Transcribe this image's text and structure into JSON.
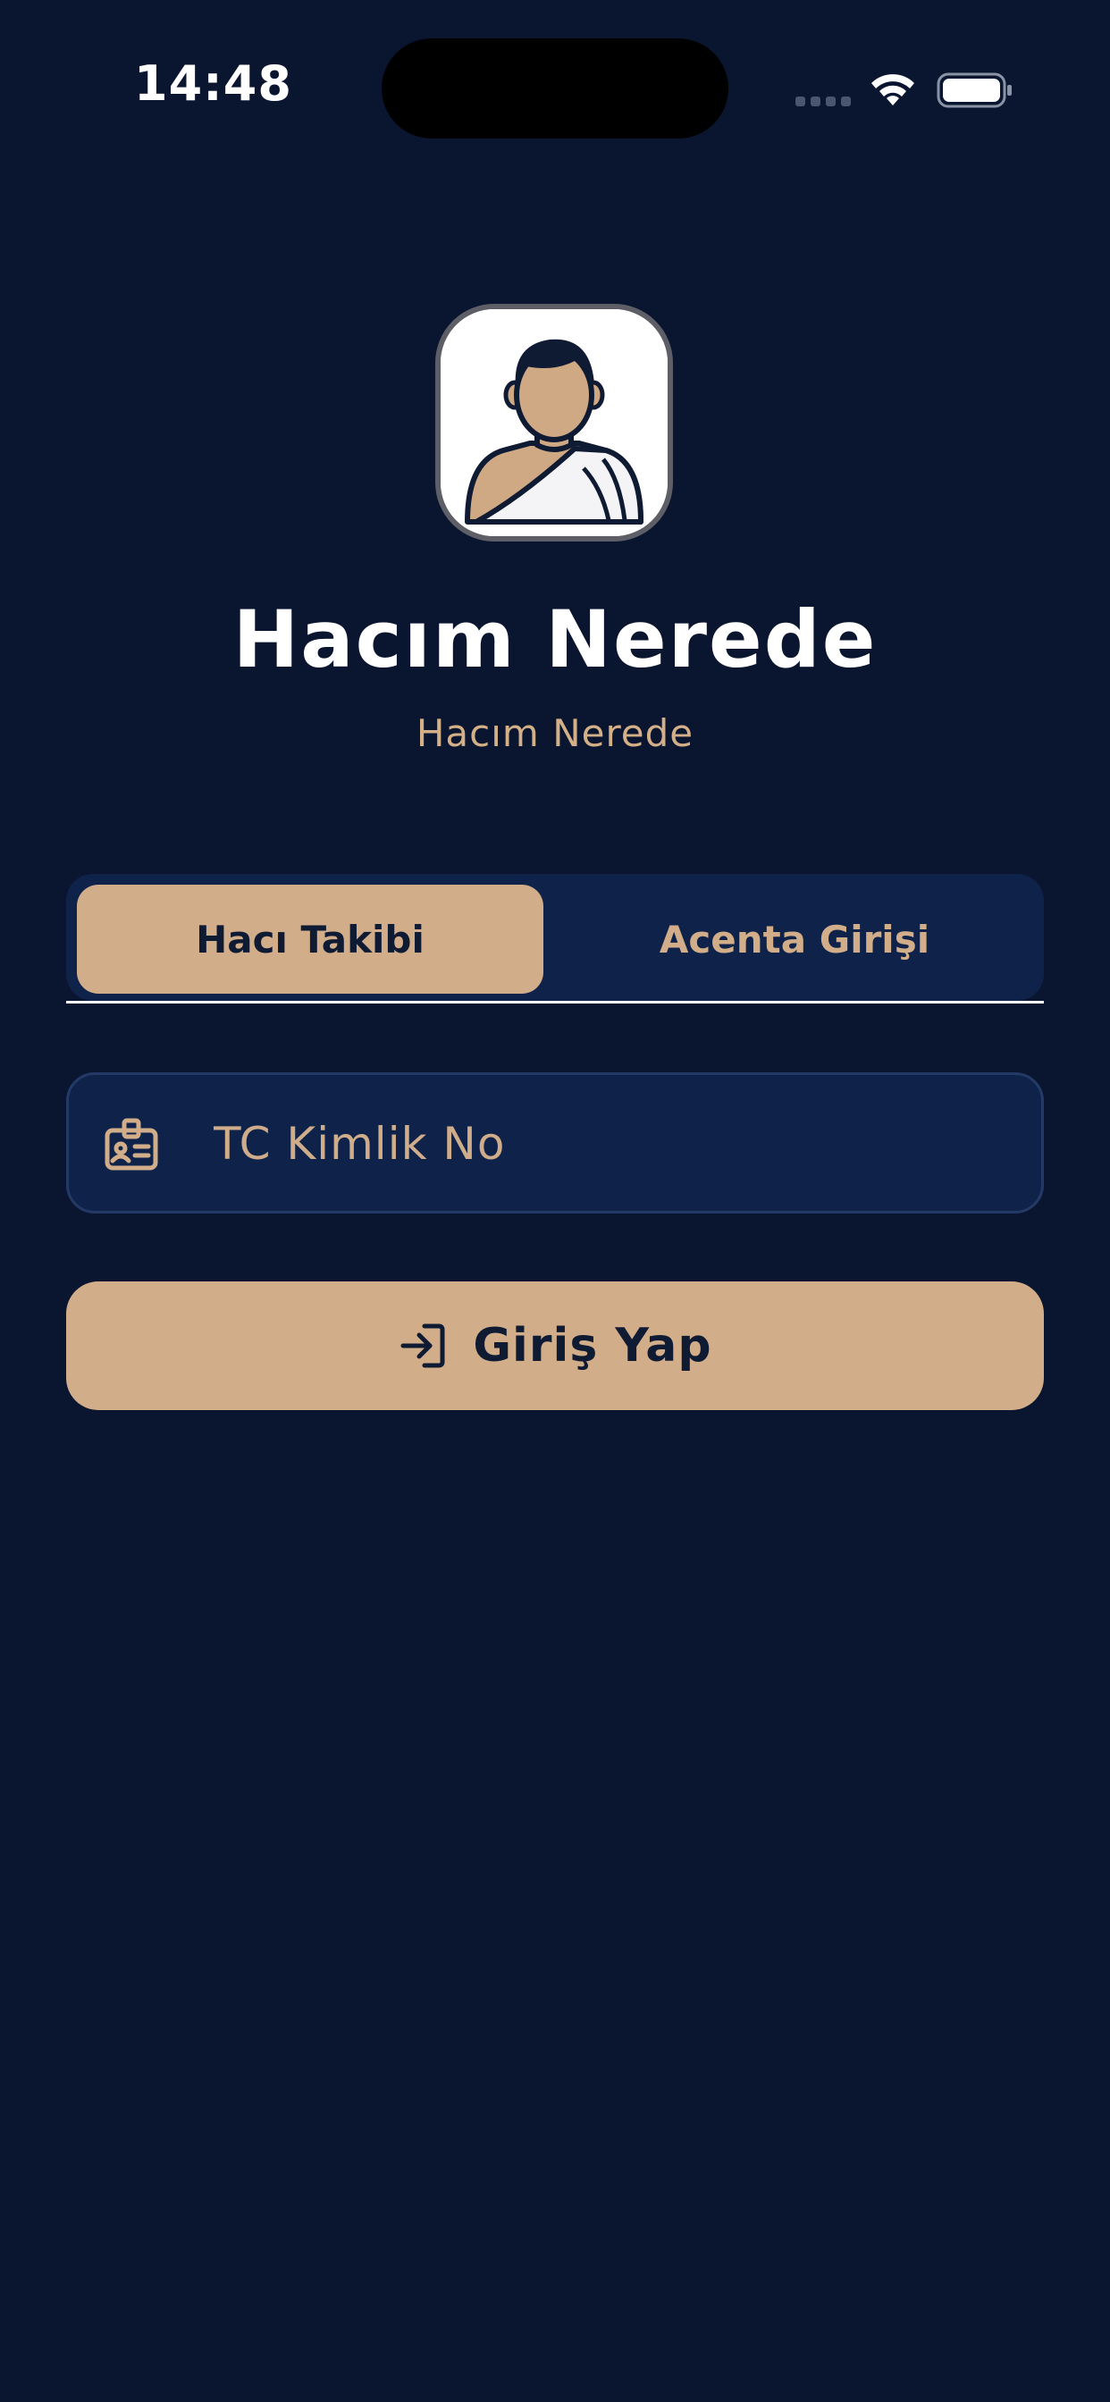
{
  "status_bar": {
    "time": "14:48"
  },
  "app": {
    "title": "Hacım Nerede",
    "subtitle": "Hacım Nerede",
    "logo_icon": "pilgrim-avatar-icon"
  },
  "tabs": [
    {
      "label": "Hacı Takibi",
      "active": true
    },
    {
      "label": "Acenta Girişi",
      "active": false
    }
  ],
  "form": {
    "tc_placeholder": "TC Kimlik No",
    "tc_value": "",
    "input_icon": "id-badge-icon",
    "login_label": "Giriş Yap",
    "login_icon": "login-arrow-icon"
  },
  "colors": {
    "background": "#0a1530",
    "surface": "#0f234a",
    "accent": "#d1ad89",
    "text_dark": "#0f1a33",
    "text_light": "#ffffff"
  }
}
